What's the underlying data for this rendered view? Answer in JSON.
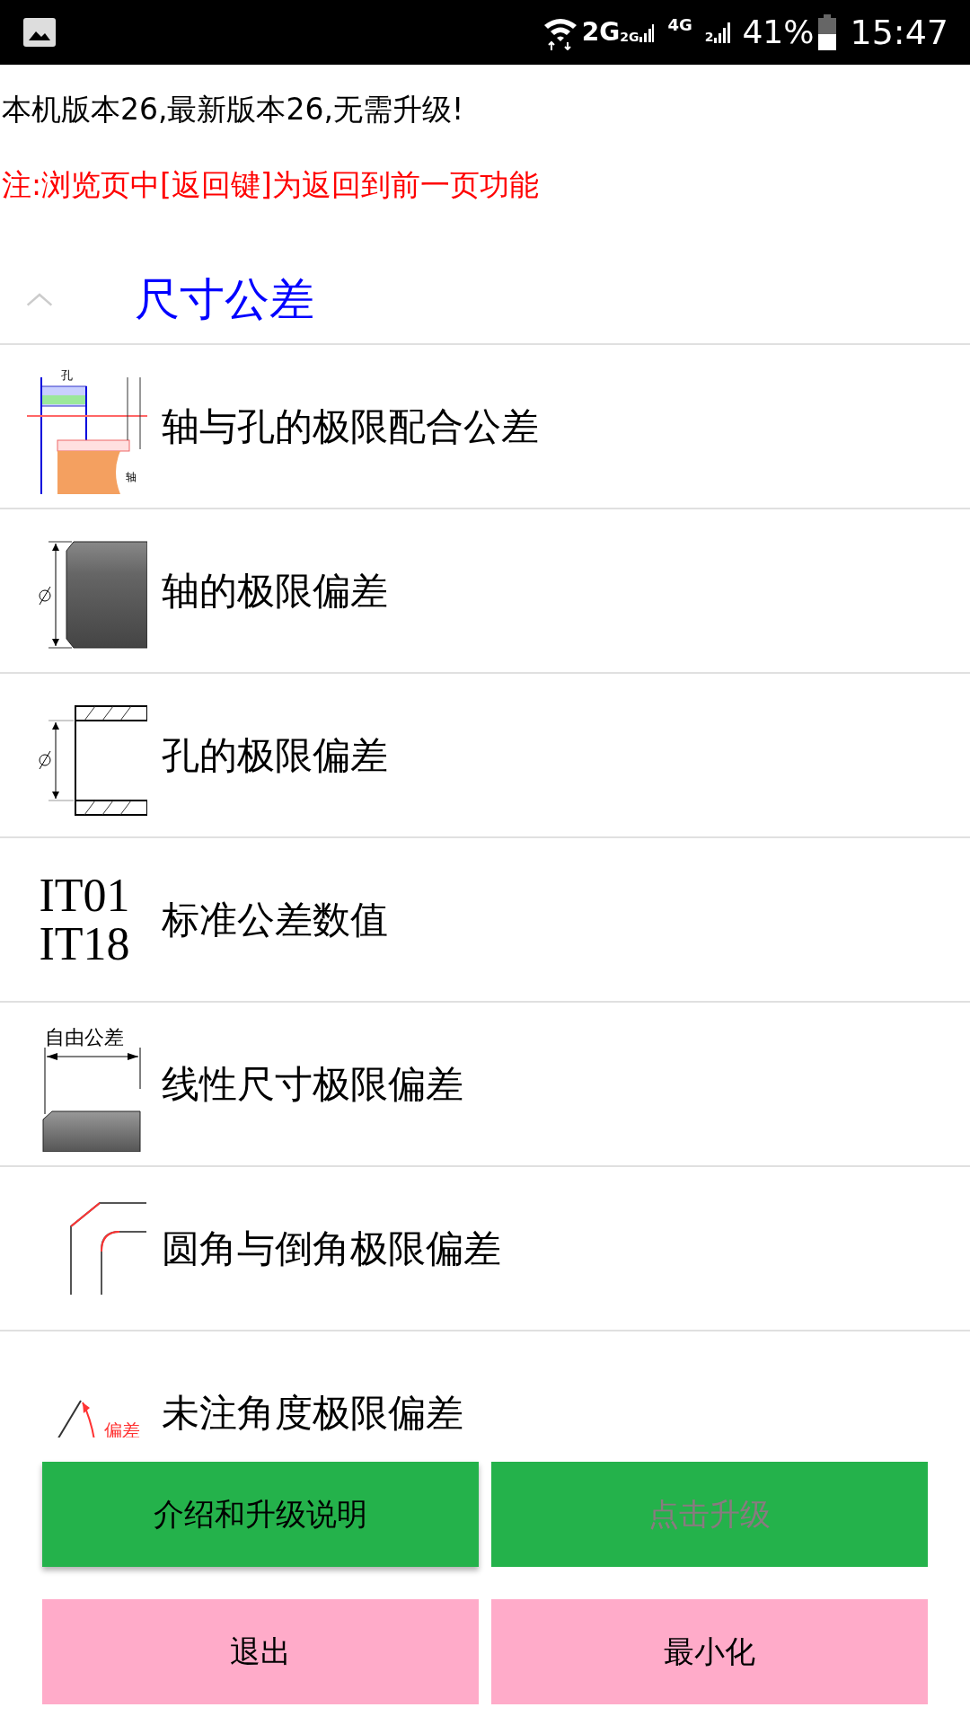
{
  "status_bar": {
    "network_labels": [
      "2G",
      "2G",
      "4G",
      "2"
    ],
    "battery": "41%",
    "time": "15:47"
  },
  "version_text": "本机版本26,最新版本26,无需升级!",
  "note": "注:浏览页中[返回键]为返回到前一页功能",
  "section": {
    "title": "尺寸公差",
    "expanded": true,
    "items": [
      {
        "label": "轴与孔的极限配合公差",
        "thumb": {
          "kind": "fit",
          "labels": [
            "孔",
            "轴"
          ]
        }
      },
      {
        "label": "轴的极限偏差",
        "thumb": {
          "kind": "shaft"
        }
      },
      {
        "label": "孔的极限偏差",
        "thumb": {
          "kind": "hole"
        }
      },
      {
        "label": "标准公差数值",
        "thumb": {
          "kind": "text",
          "labels": [
            "IT01",
            "IT18"
          ]
        }
      },
      {
        "label": "线性尺寸极限偏差",
        "thumb": {
          "kind": "linear",
          "labels": [
            "自由公差"
          ]
        }
      },
      {
        "label": "圆角与倒角极限偏差",
        "thumb": {
          "kind": "corner"
        }
      },
      {
        "label": "未注角度极限偏差",
        "thumb": {
          "kind": "angle",
          "labels": [
            "偏差"
          ]
        }
      }
    ]
  },
  "buttons": [
    {
      "label": "介绍和升级说明",
      "kind": "info",
      "disabled": false
    },
    {
      "label": "点击升级",
      "kind": "info",
      "disabled": true
    },
    {
      "label": "退出",
      "kind": "action",
      "disabled": false
    },
    {
      "label": "最小化",
      "kind": "action",
      "disabled": false
    }
  ]
}
